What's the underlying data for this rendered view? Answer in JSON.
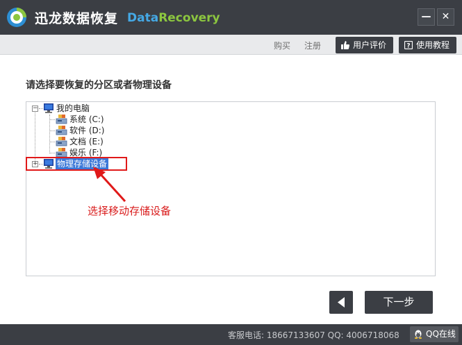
{
  "app": {
    "title": "迅龙数据恢复",
    "brand_part1": "Data",
    "brand_part2": "Recovery",
    "minimize_label": "—",
    "close_label": "✕"
  },
  "toolbar": {
    "buy_label": "购买",
    "register_label": "注册",
    "review_label": "用户评价",
    "tutorial_label": "使用教程"
  },
  "main": {
    "prompt": "请选择要恢复的分区或者物理设备",
    "tree": {
      "root_label": "我的电脑",
      "root_expander": "−",
      "drives": [
        {
          "label": "系统 (C:)"
        },
        {
          "label": "软件 (D:)"
        },
        {
          "label": "文档 (E:)"
        },
        {
          "label": "娱乐 (F:)"
        }
      ],
      "physical_label": "物理存储设备",
      "physical_expander": "+"
    },
    "annotation": "选择移动存储设备"
  },
  "nav": {
    "back_icon": "triangle-left-icon",
    "next_label": "下一步"
  },
  "status": {
    "contact": "客服电话: 18667133607 QQ: 4006718068",
    "qq_label": "QQ在线"
  },
  "colors": {
    "titlebar": "#3b3e44",
    "accent_blue": "#45a9e6",
    "accent_green": "#8cc63f",
    "annotation_red": "#e01919",
    "selection": "#3b78d8"
  }
}
